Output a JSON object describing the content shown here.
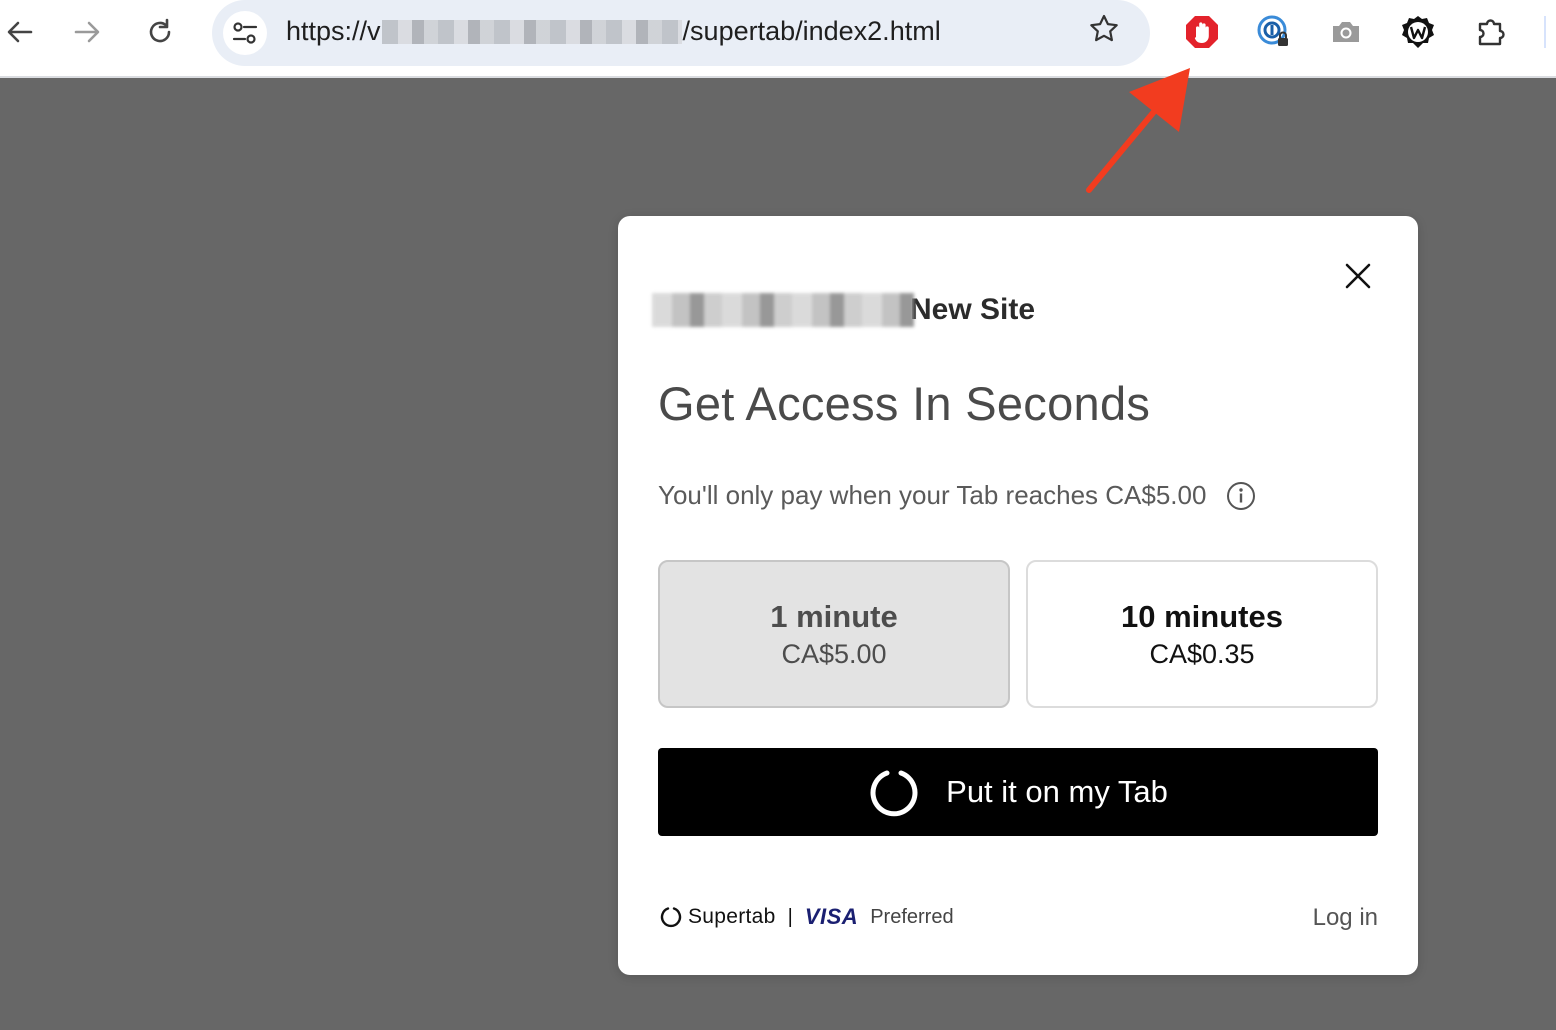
{
  "browser": {
    "url_prefix": "https://v",
    "url_suffix": "/supertab/index2.html",
    "icons": {
      "back": "back-arrow-icon",
      "forward": "forward-arrow-icon",
      "reload": "reload-icon",
      "site_settings": "tune-icon",
      "bookmark": "star-icon",
      "extensions": [
        "adblock-stop-hand-icon",
        "password-lock-icon",
        "camera-icon",
        "w-badge-icon",
        "puzzle-extensions-icon"
      ]
    }
  },
  "modal": {
    "site_name": "New Site",
    "headline": "Get Access In Seconds",
    "note": "You'll only pay when your Tab reaches CA$5.00",
    "options": [
      {
        "duration": "1 minute",
        "price": "CA$5.00",
        "selected": true
      },
      {
        "duration": "10 minutes",
        "price": "CA$0.35",
        "selected": false
      }
    ],
    "cta": "Put it on my Tab",
    "footer": {
      "brand": "Supertab",
      "separator": "|",
      "visa": "VISA",
      "preferred": "Preferred",
      "login": "Log in"
    }
  },
  "colors": {
    "backdrop": "#676767",
    "cta_bg": "#000000",
    "annotation_arrow": "#f23c1f",
    "adblock_red": "#e3222b"
  }
}
